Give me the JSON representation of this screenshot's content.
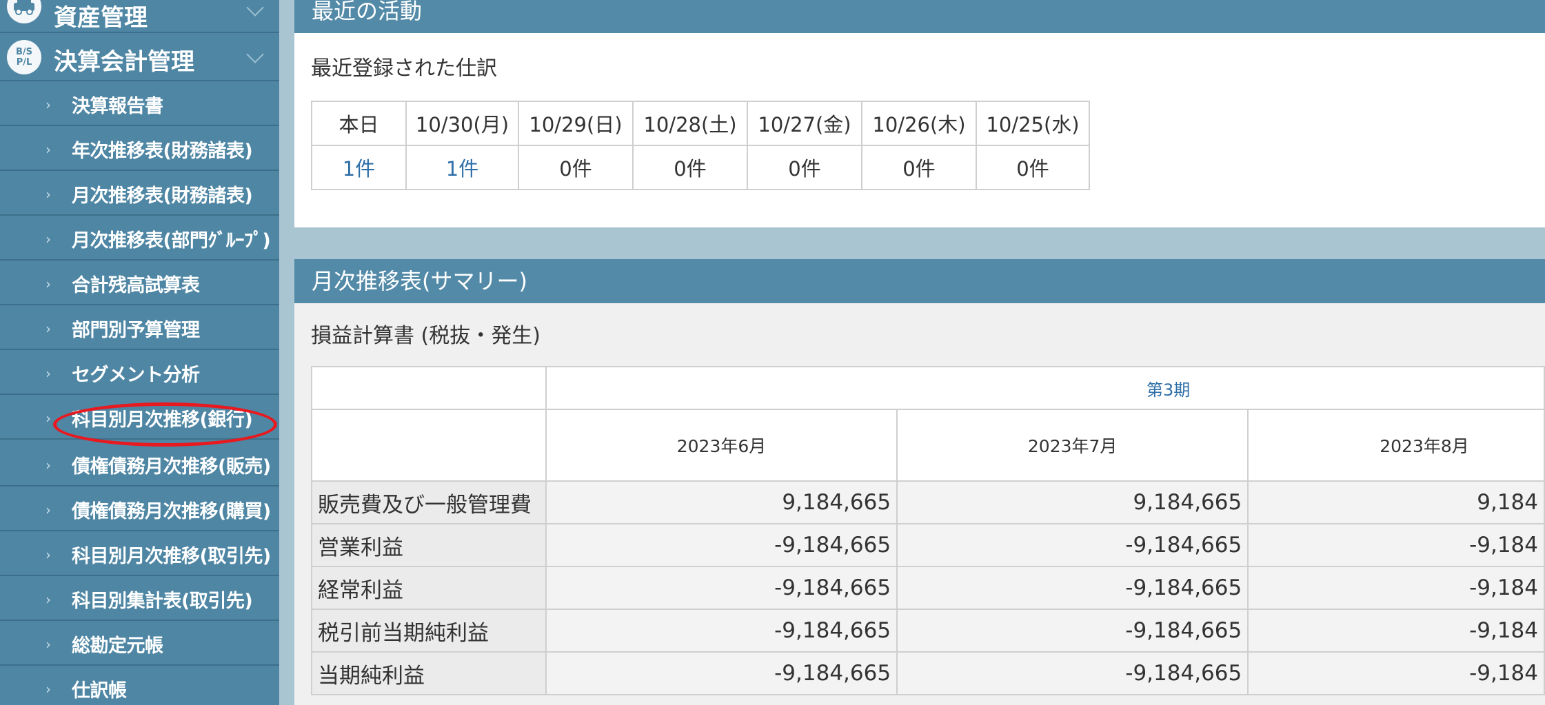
{
  "sidebar": {
    "categories": [
      {
        "label": "資産管理",
        "icon": "car-icon"
      },
      {
        "label": "決算会計管理",
        "icon": "bs-pl-icon",
        "icon_text": "B/S P/L"
      }
    ],
    "items": [
      {
        "label": "決算報告書"
      },
      {
        "label": "年次推移表(財務諸表)"
      },
      {
        "label": "月次推移表(財務諸表)"
      },
      {
        "label": "月次推移表(部門ｸﾞﾙｰﾌﾟ)"
      },
      {
        "label": "合計残高試算表"
      },
      {
        "label": "部門別予算管理"
      },
      {
        "label": "セグメント分析"
      },
      {
        "label": "科目別月次推移(銀行)"
      },
      {
        "label": "債権債務月次推移(販売)"
      },
      {
        "label": "債権債務月次推移(購買)"
      },
      {
        "label": "科目別月次推移(取引先)"
      },
      {
        "label": "科目別集計表(取引先)"
      },
      {
        "label": "総勘定元帳"
      },
      {
        "label": "仕訳帳"
      }
    ],
    "highlight_color": "#e8191f"
  },
  "activity": {
    "title": "最近の活動",
    "subtitle": "最近登録された仕訳",
    "headers": [
      "本日",
      "10/30(月)",
      "10/29(日)",
      "10/28(土)",
      "10/27(金)",
      "10/26(木)",
      "10/25(水)"
    ],
    "counts": [
      "1件",
      "1件",
      "0件",
      "0件",
      "0件",
      "0件",
      "0件"
    ]
  },
  "summary": {
    "title": "月次推移表(サマリー)",
    "subtitle": "損益計算書 (税抜・発生)",
    "period": "第3期",
    "months": [
      "2023年6月",
      "2023年7月",
      "2023年8月"
    ],
    "rows": [
      {
        "label": "販売費及び一般管理費",
        "values": [
          "9,184,665",
          "9,184,665",
          "9,184"
        ]
      },
      {
        "label": "営業利益",
        "values": [
          "-9,184,665",
          "-9,184,665",
          "-9,184"
        ]
      },
      {
        "label": "経常利益",
        "values": [
          "-9,184,665",
          "-9,184,665",
          "-9,184"
        ]
      },
      {
        "label": "税引前当期純利益",
        "values": [
          "-9,184,665",
          "-9,184,665",
          "-9,184"
        ]
      },
      {
        "label": "当期純利益",
        "values": [
          "-9,184,665",
          "-9,184,665",
          "-9,184"
        ]
      }
    ]
  },
  "colors": {
    "sidebar_bg": "#4e86a4",
    "header_bg": "#538aa8",
    "link": "#2f6fa8",
    "page_bg": "#a9c5d2"
  }
}
